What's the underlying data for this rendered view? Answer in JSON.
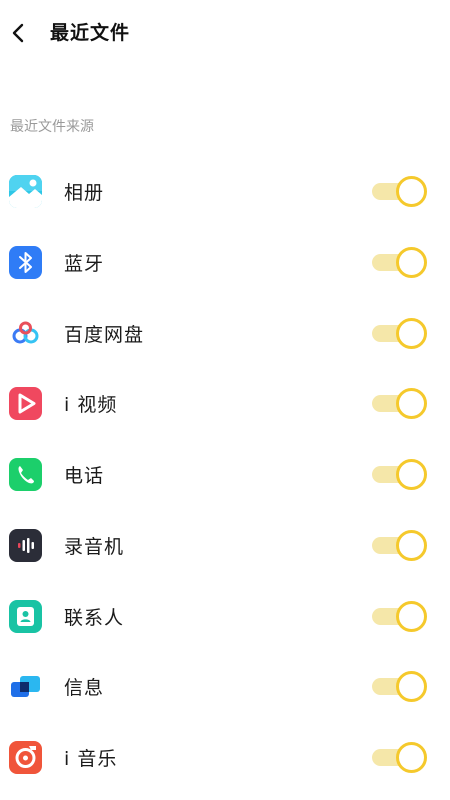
{
  "header": {
    "back_icon": "chevron-left-icon",
    "title": "最近文件"
  },
  "section": {
    "label": "最近文件来源"
  },
  "colors": {
    "toggle_on": "#f5c92c",
    "toggle_track": "#f5e7a9",
    "section_label": "#9a9a9a"
  },
  "sources": [
    {
      "label": "相册",
      "icon": "photo-album-icon",
      "enabled": true
    },
    {
      "label": "蓝牙",
      "icon": "bluetooth-icon",
      "enabled": true
    },
    {
      "label": "百度网盘",
      "icon": "baidu-netdisk-icon",
      "enabled": true
    },
    {
      "label": "i 视频",
      "icon": "video-play-icon",
      "enabled": true
    },
    {
      "label": "电话",
      "icon": "phone-icon",
      "enabled": true
    },
    {
      "label": "录音机",
      "icon": "recorder-icon",
      "enabled": true
    },
    {
      "label": "联系人",
      "icon": "contacts-icon",
      "enabled": true
    },
    {
      "label": "信息",
      "icon": "messages-icon",
      "enabled": true
    },
    {
      "label": "i 音乐",
      "icon": "music-icon",
      "enabled": true
    }
  ]
}
